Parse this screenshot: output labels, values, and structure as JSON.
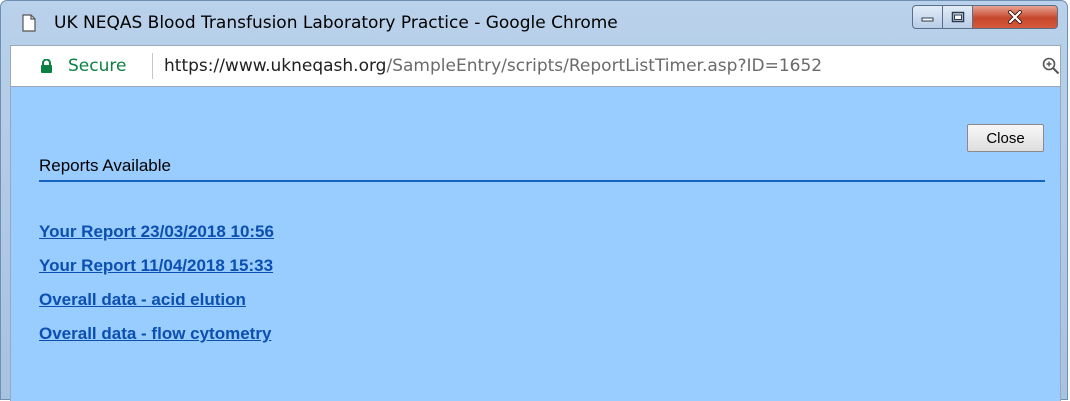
{
  "window": {
    "title": "UK NEQAS Blood Transfusion Laboratory Practice - Google Chrome",
    "controls": {
      "minimize_icon": "minimize-icon",
      "maximize_icon": "maximize-icon",
      "close_icon": "close-icon"
    }
  },
  "addressbar": {
    "secure_label": "Secure",
    "url_host": "https://www.ukneqash.org",
    "url_path": "/SampleEntry/scripts/ReportListTimer.asp?ID=1652",
    "zoom_icon": "zoom-icon"
  },
  "content": {
    "close_label": "Close",
    "heading": "Reports Available",
    "reports": [
      {
        "label": "Your Report 23/03/2018 10:56"
      },
      {
        "label": "Your Report 11/04/2018 15:33"
      },
      {
        "label": "Overall data - acid elution"
      },
      {
        "label": "Overall data - flow cytometry"
      }
    ]
  },
  "colors": {
    "content_bg": "#99ccff",
    "link": "#0b4fb0",
    "rule": "#1565c0",
    "secure": "#0b8043"
  }
}
